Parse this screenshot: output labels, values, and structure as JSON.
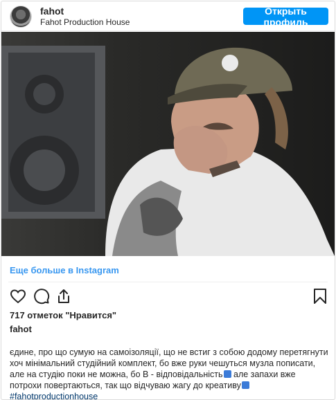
{
  "header": {
    "username": "fahot",
    "subtitle": "Fahot Production House",
    "open_profile_label": "Открыть профиль"
  },
  "post": {
    "more_link": "Еще больше в Instagram",
    "likes_text": "717 отметок \"Нравится\"",
    "author": "fahot",
    "caption_line1": "єдине, про що сумую на самоізоляції, що не встиг з собою додому перетягнути",
    "caption_line2": "хоч мінімальний студійний комплект, бо вже руки чешуться музла пописати,",
    "caption_line3a": "але на студію поки не можна, бо В - відповідальність",
    "caption_line3b": " але запахи вже",
    "caption_line4": "потрохи повертаються, так що відчуваю жагу до креативу",
    "hashtag": "#fahotproductionhouse"
  },
  "icons": {
    "like": "heart-icon",
    "comment": "comment-icon",
    "share": "share-icon",
    "save": "bookmark-icon",
    "emoji_on": "on-arrow-emoji",
    "emoji_soon": "soon-arrow-emoji"
  },
  "colors": {
    "accent": "#0095f6",
    "link": "#3897f0",
    "hashtag": "#00376b",
    "text": "#262626"
  }
}
